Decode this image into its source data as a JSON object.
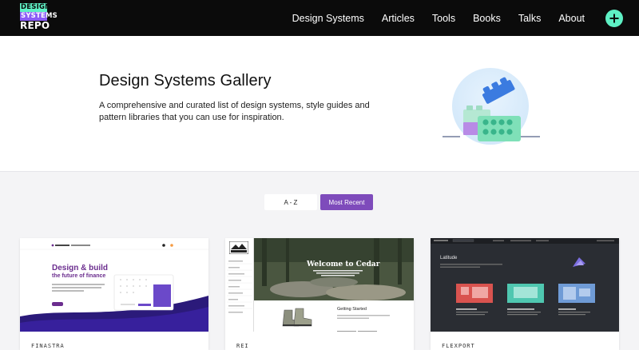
{
  "header": {
    "logo": {
      "line1": "DESIGN",
      "line2": "SYSTEMS",
      "line3": "REPO"
    },
    "nav": [
      "Design Systems",
      "Articles",
      "Tools",
      "Books",
      "Talks",
      "About"
    ],
    "add_icon": "plus-circle-icon",
    "colors": {
      "background": "#0b0b0b",
      "accent": "#5ef0c4",
      "logo_purple": "#8b5cf6"
    }
  },
  "hero": {
    "title": "Design Systems Gallery",
    "description": "A comprehensive and curated list of design systems, style guides and pattern libraries that you can use for inspiration."
  },
  "sort": {
    "options": [
      "A - Z",
      "Most Recent"
    ],
    "active": "Most Recent",
    "active_color": "#7e4bbb"
  },
  "cards": [
    {
      "name": "FINASTRA",
      "thumb": {
        "headline": "Design & build",
        "subheadline": "the future of finance",
        "brand": "finastra"
      }
    },
    {
      "name": "REI",
      "thumb": {
        "headline": "Welcome to Cedar",
        "section": "Getting Started",
        "brand": "REI"
      }
    },
    {
      "name": "FLEXPORT",
      "thumb": {
        "headline": "Latitude"
      }
    }
  ]
}
